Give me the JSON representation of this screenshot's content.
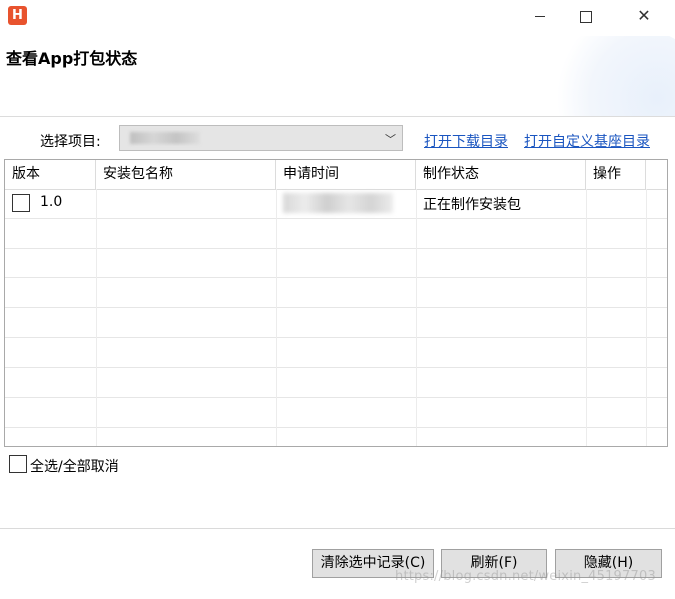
{
  "window": {
    "app_icon_text": "H",
    "minimize_icon": "minimize-icon",
    "maximize_icon": "maximize-icon",
    "close_icon": "close-icon",
    "close_glyph": "✕"
  },
  "header": {
    "title": "查看App打包状态"
  },
  "project": {
    "label": "选择项目:",
    "arrow_glyph": "﹀",
    "link_download": "打开下载目录",
    "link_base": "打开自定义基座目录"
  },
  "table": {
    "columns": [
      "版本",
      "安装包名称",
      "申请时间",
      "制作状态",
      "操作"
    ],
    "rows": [
      {
        "version": "1.0",
        "package_name": "",
        "status": "正在制作安装包",
        "checked": false
      }
    ]
  },
  "select_all": {
    "label": "全选/全部取消",
    "checked": false
  },
  "buttons": {
    "clear": "清除选中记录(C)",
    "refresh": "刷新(F)",
    "hide": "隐藏(H)"
  },
  "watermark": "https://blog.csdn.net/weixin_45197703"
}
